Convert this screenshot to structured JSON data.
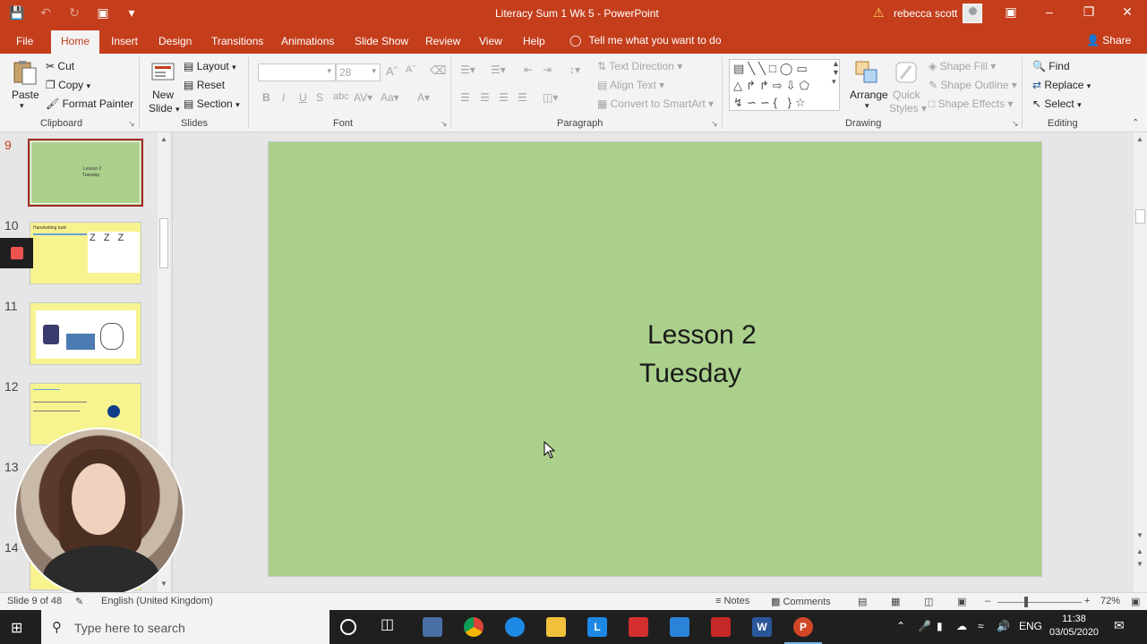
{
  "titlebar": {
    "doc_title": "Literacy Sum 1 Wk 5  -  PowerPoint",
    "user_name": "rebecca scott"
  },
  "tabs": [
    "File",
    "Home",
    "Insert",
    "Design",
    "Transitions",
    "Animations",
    "Slide Show",
    "Review",
    "View",
    "Help"
  ],
  "tell_me": "Tell me what you want to do",
  "share": "Share",
  "ribbon": {
    "clipboard": {
      "paste": "Paste",
      "cut": "Cut",
      "copy": "Copy",
      "format_painter": "Format Painter",
      "label": "Clipboard"
    },
    "slides": {
      "new_slide_1": "New",
      "new_slide_2": "Slide",
      "layout": "Layout",
      "reset": "Reset",
      "section": "Section",
      "label": "Slides"
    },
    "font": {
      "size": "28",
      "label": "Font"
    },
    "paragraph": {
      "text_direction": "Text Direction",
      "align_text": "Align Text",
      "convert_smartart": "Convert to SmartArt",
      "label": "Paragraph"
    },
    "drawing": {
      "arrange": "Arrange",
      "quick_styles_1": "Quick",
      "quick_styles_2": "Styles",
      "shape_fill": "Shape Fill",
      "shape_outline": "Shape Outline",
      "shape_effects": "Shape Effects",
      "label": "Drawing"
    },
    "editing": {
      "find": "Find",
      "replace": "Replace",
      "select": "Select",
      "label": "Editing"
    }
  },
  "thumbnails": [
    {
      "num": "9",
      "title_1": "Lesson 2",
      "title_2": "Tuesday"
    },
    {
      "num": "10",
      "title": "Handwriting task"
    },
    {
      "num": "11"
    },
    {
      "num": "12"
    },
    {
      "num": "13"
    },
    {
      "num": "14"
    }
  ],
  "slide": {
    "line1": "Lesson 2",
    "line2": "Tuesday"
  },
  "status": {
    "slide_info": "Slide 9 of 48",
    "language": "English (United Kingdom)",
    "notes": "Notes",
    "comments": "Comments",
    "zoom": "72%"
  },
  "taskbar": {
    "search_placeholder": "Type here to search",
    "lang": "ENG",
    "time": "11:38",
    "date": "03/05/2020"
  },
  "colors": {
    "accent": "#c43e1c",
    "slide_bg": "#abd08c",
    "thumb_yellow": "#f7f48f"
  }
}
